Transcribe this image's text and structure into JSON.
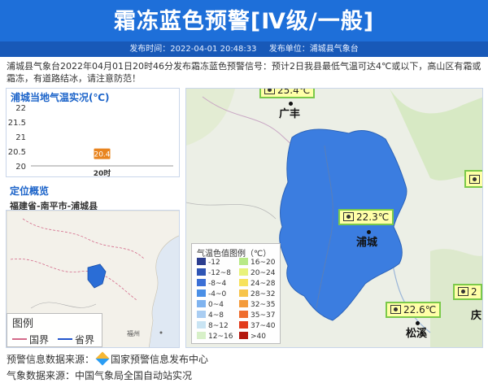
{
  "header": {
    "title": "霜冻蓝色预警[Ⅳ级/一般]",
    "publish_time": "发布时间：2022-04-01 20:48:33",
    "publisher": "发布单位：浦城县气象台"
  },
  "notice": "浦城县气象台2022年04月01日20时46分发布霜冻蓝色预警信号：预计2日我县最低气温可达4℃或以下，高山区有霜或霜冻，有道路结冰，请注意防范！",
  "temp_panel": {
    "title": "浦城当地气温实况(℃)"
  },
  "chart_data": {
    "type": "scatter",
    "categories": [
      "20时"
    ],
    "values": [
      20.4
    ],
    "ylim": [
      20,
      22
    ],
    "yticks": [
      "22",
      "21.5",
      "21",
      "20.5",
      "20"
    ],
    "data_labels": [
      "20.4"
    ],
    "marker_color": "#e8841f"
  },
  "location": {
    "title": "定位概览",
    "path": "福建省-南平市-浦城县"
  },
  "minimap": {
    "legend_title": "图例",
    "legend_items": [
      {
        "label": "国界",
        "color": "#d46a8a"
      },
      {
        "label": "省界",
        "color": "#2255cc"
      }
    ],
    "place_label": "福州"
  },
  "mainmap": {
    "region_color": "#3b7de0",
    "temp_labels": [
      {
        "value": "25.4℃"
      },
      {
        "value": "22.3℃"
      },
      {
        "value": "22.6℃"
      },
      {
        "value": "2"
      }
    ],
    "cities": [
      "广丰",
      "浦城",
      "松溪",
      "庆"
    ],
    "color_legend": {
      "title": "气温色值图例（℃）",
      "items": [
        {
          "label": "-12",
          "color": "#2c3e8f"
        },
        {
          "label": "16~20",
          "color": "#b8e986"
        },
        {
          "label": "-12~8",
          "color": "#2f55b5"
        },
        {
          "label": "20~24",
          "color": "#e8f27a"
        },
        {
          "label": "-8~4",
          "color": "#3b6fd6"
        },
        {
          "label": "24~28",
          "color": "#f7e25c"
        },
        {
          "label": "-4~0",
          "color": "#4a8fe6"
        },
        {
          "label": "28~32",
          "color": "#f7c44a"
        },
        {
          "label": "0~4",
          "color": "#7fb3ef"
        },
        {
          "label": "32~35",
          "color": "#f49b3b"
        },
        {
          "label": "4~8",
          "color": "#a9cdf2"
        },
        {
          "label": "35~37",
          "color": "#ef6d2e"
        },
        {
          "label": "8~12",
          "color": "#c9e4f3"
        },
        {
          "label": "37~40",
          "color": "#e23c1c"
        },
        {
          "label": "12~16",
          "color": "#d7f0c8"
        },
        {
          "label": ">40",
          "color": "#b3180e"
        }
      ]
    }
  },
  "footer": {
    "warning_source": "预警信息数据来源：",
    "warning_source_name": "国家预警信息发布中心",
    "weather_source": "气象数据来源：中国气象局全国自动站实况"
  }
}
